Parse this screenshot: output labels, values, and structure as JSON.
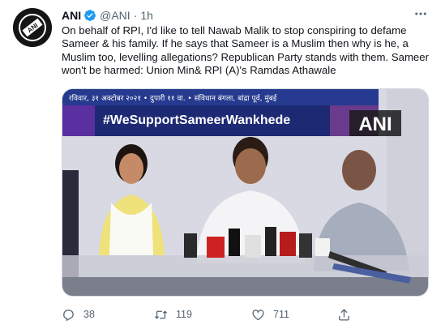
{
  "tweet": {
    "author_name": "ANI",
    "handle": "@ANI",
    "separator": "·",
    "time": "1h",
    "more_icon": "more-dots-icon",
    "text": "On behalf of RPI, I'd like to tell Nawab Malik to stop conspiring to defame Sameer & his family. If he says that Sameer is a Muslim then why is he, a Muslim too, levelling allegations? Republican Party stands with them. Sameer won't be harmed: Union Min& RPI (A)'s Ramdas Athawale",
    "avatar_text": "ANI",
    "verified_color": "#1d9bf0",
    "media": {
      "banner_top": "रविवार, ३१ अक्टोबर २०२१ • दुपारी ११ वा. • संविधान बंगला, बांद्रा पूर्व, मुंबई",
      "banner_hashtag": "#WeSupportSameerWankhede",
      "watermark": "ANI"
    },
    "actions": {
      "reply_count": "38",
      "retweet_count": "119",
      "like_count": "711"
    }
  }
}
